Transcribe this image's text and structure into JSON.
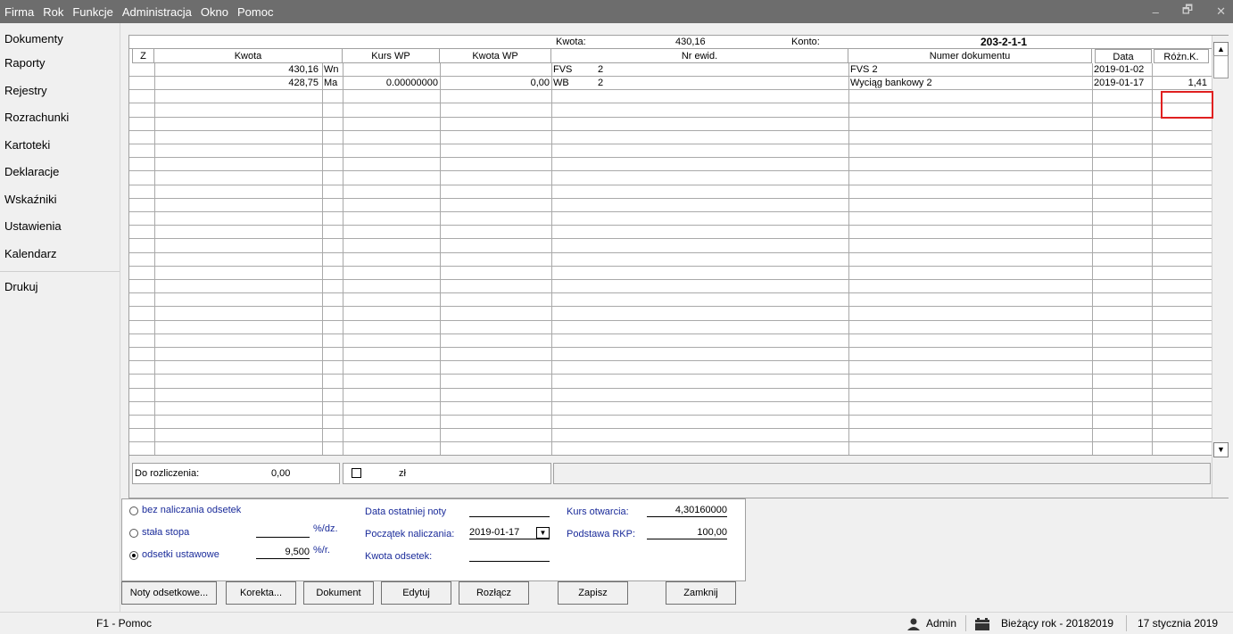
{
  "menu": [
    "Firma",
    "Rok",
    "Funkcje",
    "Administracja",
    "Okno",
    "Pomoc"
  ],
  "window_controls": {
    "minimize": "–",
    "restore": "🗗",
    "close": "✕"
  },
  "sidebar": {
    "items": [
      "Dokumenty",
      "Raporty",
      "Rejestry",
      "Rozrachunki",
      "Kartoteki",
      "Deklaracje",
      "Wskaźniki",
      "Ustawienia",
      "Kalendarz"
    ],
    "print": "Drukuj"
  },
  "info": {
    "kwota_label": "Kwota:",
    "kwota_value": "430,16",
    "konto_label": "Konto:",
    "konto_value": "203-2-1-1"
  },
  "columns": [
    "Z",
    "Kwota",
    "Kurs WP",
    "Kwota WP",
    "Nr ewid.",
    "Numer dokumentu",
    "Data",
    "Różn.K."
  ],
  "rows": [
    {
      "kwota": "430,16",
      "strona": "Wn",
      "kurs": "",
      "kwota_wp": "",
      "typ": "FVS",
      "nr": "2",
      "numer_dok": "FVS 2",
      "data": "2019-01-02",
      "roznk": ""
    },
    {
      "kwota": "428,75",
      "strona": "Ma",
      "kurs": "0.00000000",
      "kwota_wp": "0,00",
      "typ": "WB",
      "nr": "2",
      "numer_dok": "Wyciąg bankowy 2",
      "data": "2019-01-17",
      "roznk": "1,41"
    }
  ],
  "summary": {
    "label": "Do rozliczenia:",
    "value": "0,00",
    "currency": "zł"
  },
  "interest": {
    "radio1": "bez naliczania odsetek",
    "radio2": "stała stopa",
    "radio3": "odsetki ustawowe",
    "stopa_unit": "%/dz.",
    "ustawowe_value": "9,500",
    "ustawowe_unit": "%/r.",
    "data_noty_label": "Data ostatniej noty",
    "data_noty_value": "",
    "poczatek_label": "Początek naliczania:",
    "poczatek_value": "2019-01-17",
    "kwota_odsetek_label": "Kwota odsetek:",
    "kwota_odsetek_value": "",
    "kurs_label": "Kurs otwarcia:",
    "kurs_value": "4,30160000",
    "podstawa_label": "Podstawa RKP:",
    "podstawa_value": "100,00"
  },
  "buttons": [
    "Noty odsetkowe...",
    "Korekta...",
    "Dokument",
    "Edytuj",
    "Rozłącz",
    "Zapisz",
    "Zamknij"
  ],
  "status": {
    "help": "F1 - Pomoc",
    "user": "Admin",
    "year": "Bieżący rok - 20182019",
    "date": "17 stycznia 2019"
  }
}
